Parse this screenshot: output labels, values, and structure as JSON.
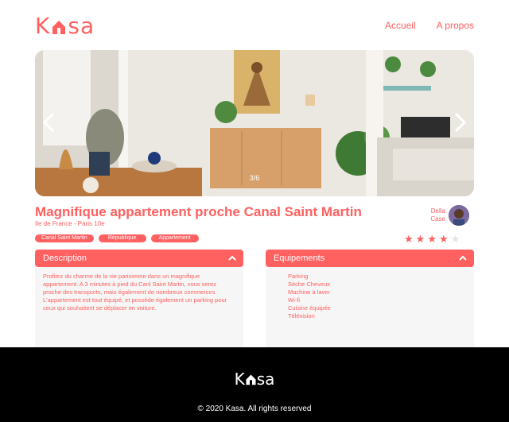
{
  "brand": {
    "logo_text_start": "K",
    "logo_text_end": "sa",
    "color": "#ff6060"
  },
  "nav": {
    "home": "Accueil",
    "about": "A propos"
  },
  "gallery": {
    "counter": "3/6",
    "prev_icon": "chevron-left-icon",
    "next_icon": "chevron-right-icon"
  },
  "listing": {
    "title": "Magnifique appartement proche Canal Saint Martin",
    "location": "Ile de France - Paris 10e",
    "tags": [
      "Canal Saint Martin",
      "République",
      "Appartement"
    ],
    "host": {
      "first_name": "Della",
      "last_name": "Case"
    },
    "rating": 4,
    "rating_max": 5
  },
  "description": {
    "label": "Description",
    "text": "Profitez du charme de la vie parisienne dans un magnifique appartement. A 3 minutes à pied du Canl Saint Martin, vous serez proche des transports, mais également de nombreux commerces. L'appartement est tout équipé, et possède également un parking pour ceux qui souhaitent se déplacer en voiture."
  },
  "equipements": {
    "label": "Equipements",
    "items": [
      "Parking",
      "Sèche Cheveux",
      "Machine à laver",
      "Wi-fi",
      "Cuisine équipée",
      "Télévision"
    ]
  },
  "footer": {
    "copyright": "© 2020 Kasa. All rights reserved"
  }
}
